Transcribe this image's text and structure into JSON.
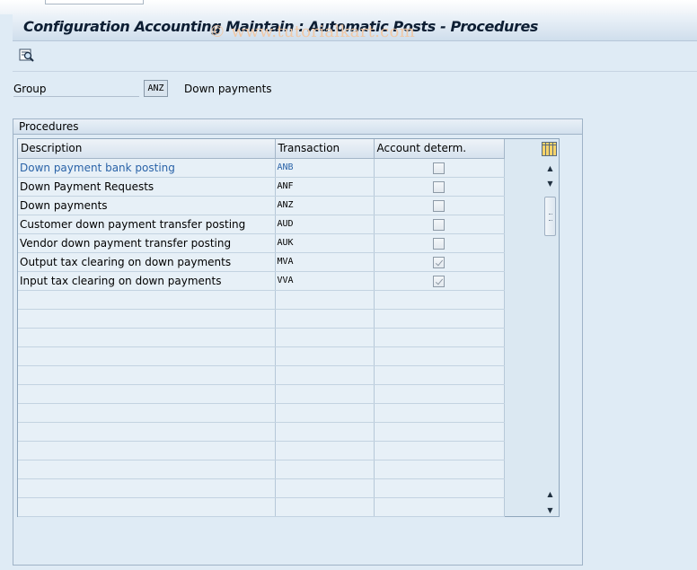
{
  "window": {
    "title": "Configuration Accounting Maintain : Automatic Posts - Procedures",
    "watermark": "© www.tutorialkart.com"
  },
  "toolbar": {
    "detail_icon": "magnifier-detail-icon"
  },
  "group": {
    "label": "Group",
    "value": "ANZ",
    "description": "Down payments"
  },
  "procedures": {
    "title": "Procedures",
    "columns": [
      "Description",
      "Transaction",
      "Account determ."
    ],
    "rows": [
      {
        "description": "Down payment bank posting",
        "transaction": "ANB",
        "account_determ": false
      },
      {
        "description": "Down Payment Requests",
        "transaction": "ANF",
        "account_determ": false
      },
      {
        "description": "Down payments",
        "transaction": "ANZ",
        "account_determ": false
      },
      {
        "description": "Customer down payment transfer posting",
        "transaction": "AUD",
        "account_determ": false
      },
      {
        "description": "Vendor down payment transfer posting",
        "transaction": "AUK",
        "account_determ": false
      },
      {
        "description": "Output tax clearing on down payments",
        "transaction": "MVA",
        "account_determ": true
      },
      {
        "description": "Input tax clearing on down payments",
        "transaction": "VVA",
        "account_determ": true
      }
    ],
    "empty_rows": 12
  },
  "colors": {
    "background": "#dfebf5",
    "link": "#2a63a8",
    "title": "#0d1e33",
    "watermark": "#f0c8a6"
  }
}
